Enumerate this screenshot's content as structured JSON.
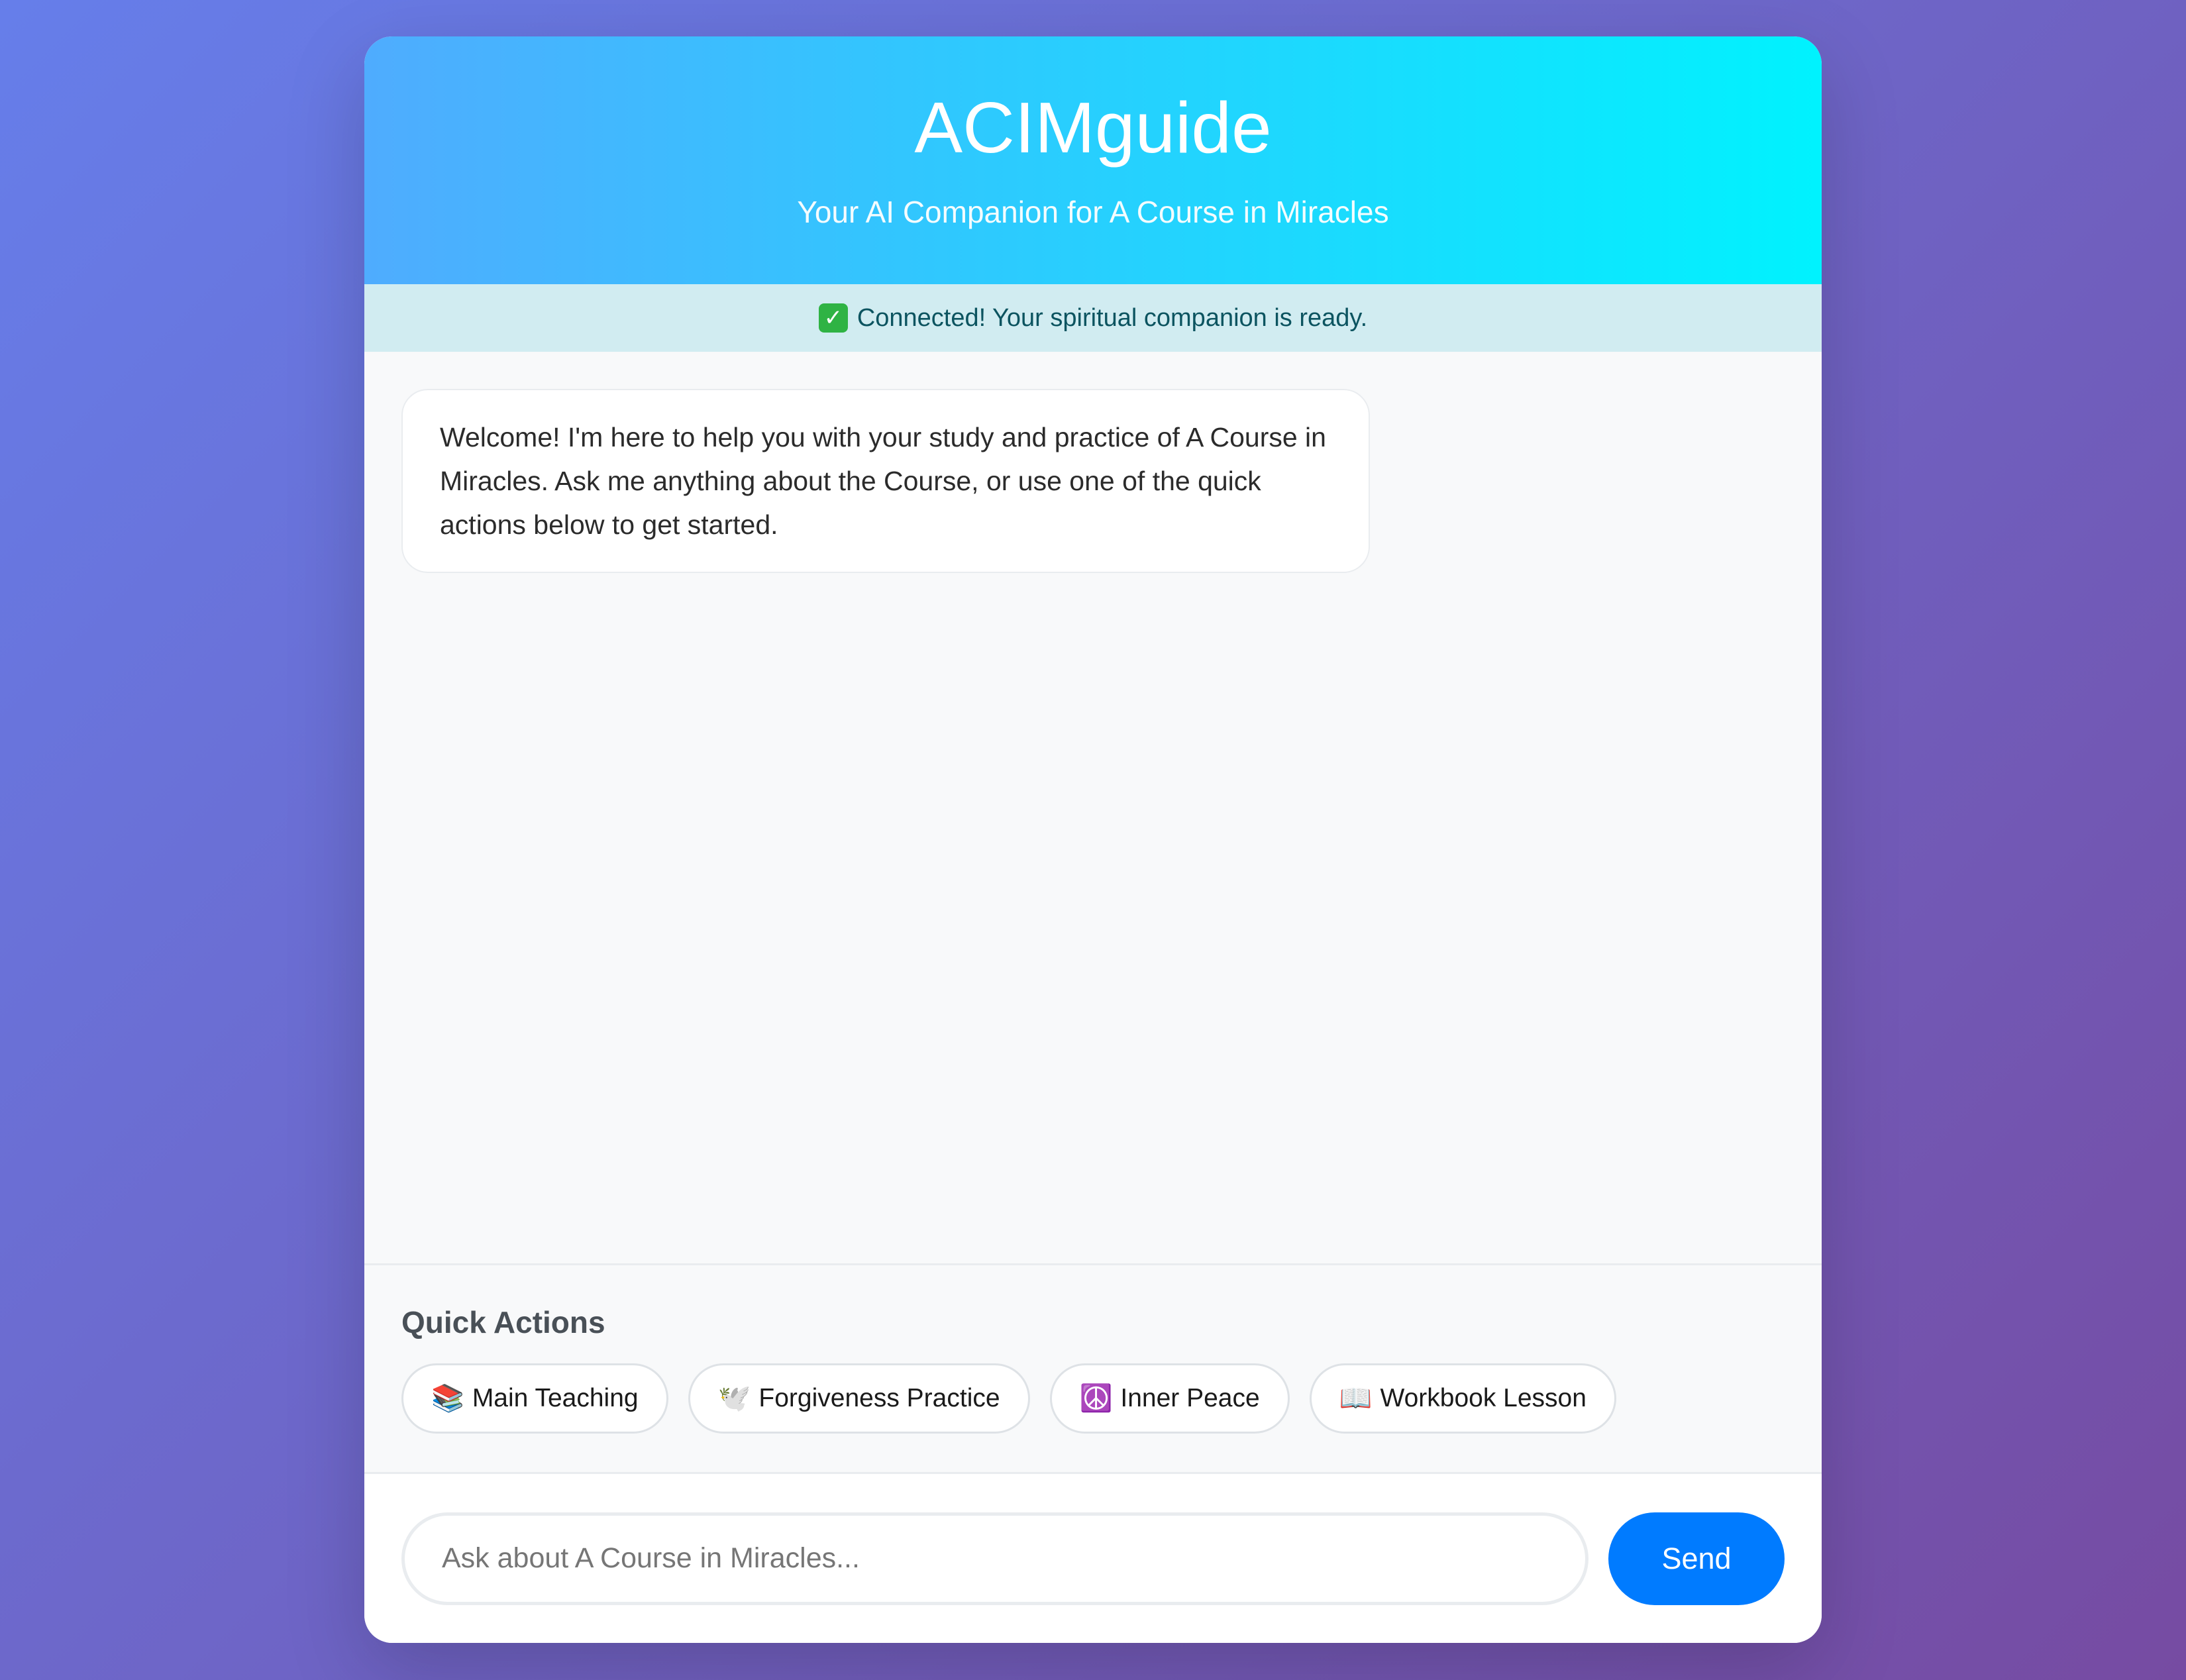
{
  "header": {
    "title": "ACIMguide",
    "subtitle": "Your AI Companion for A Course in Miracles"
  },
  "status": {
    "icon": "check-mark-icon",
    "text": "Connected! Your spiritual companion is ready.",
    "color": "#0c5460",
    "background": "#d1ecf1"
  },
  "messages": [
    {
      "role": "assistant",
      "text": "Welcome! I'm here to help you with your study and practice of A Course in Miracles. Ask me anything about the Course, or use one of the quick actions below to get started."
    }
  ],
  "quick_actions": {
    "title": "Quick Actions",
    "items": [
      {
        "emoji": "📚",
        "icon": "books-icon",
        "label": "Main Teaching"
      },
      {
        "emoji": "🕊️",
        "icon": "dove-icon",
        "label": "Forgiveness Practice"
      },
      {
        "emoji": "☮️",
        "icon": "peace-symbol-icon",
        "label": "Inner Peace"
      },
      {
        "emoji": "📖",
        "icon": "open-book-icon",
        "label": "Workbook Lesson"
      }
    ]
  },
  "input": {
    "placeholder": "Ask about A Course in Miracles...",
    "value": ""
  },
  "send_button": {
    "label": "Send"
  },
  "colors": {
    "background_gradient": [
      "#667eea",
      "#764ba2"
    ],
    "header_gradient": [
      "#4facfe",
      "#00f2fe"
    ],
    "accent": "#007bff"
  }
}
